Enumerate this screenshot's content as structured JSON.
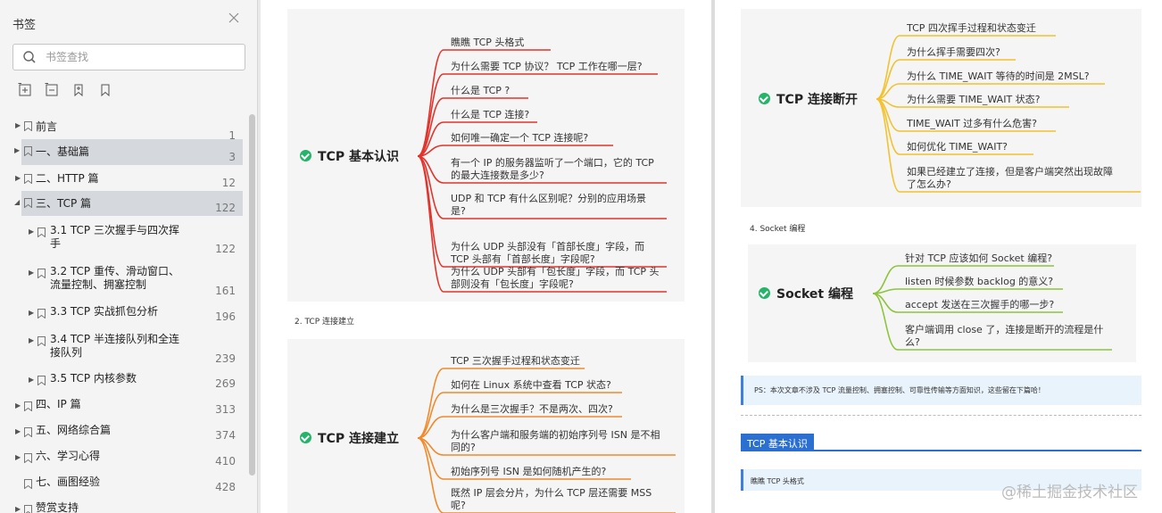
{
  "sidebar": {
    "title": "书签",
    "close_icon": "close-icon",
    "search": {
      "placeholder": "书签查找",
      "value": ""
    },
    "tools": [
      "expand-all-icon",
      "collapse-all-icon",
      "add-bookmark-icon",
      "bookmark-icon"
    ],
    "items": [
      {
        "label": "前言",
        "page": "1",
        "level": 0,
        "expanded": false,
        "selected": false
      },
      {
        "label": "一、基础篇",
        "page": "3",
        "level": 0,
        "expanded": false,
        "selected": true
      },
      {
        "label": "二、HTTP 篇",
        "page": "12",
        "level": 0,
        "expanded": false,
        "selected": false
      },
      {
        "label": "三、TCP 篇",
        "page": "122",
        "level": 0,
        "expanded": true,
        "selected": true
      },
      {
        "label": "3.1 TCP 三次握手与四次挥",
        "label2": "手",
        "page": "122",
        "level": 1,
        "selected": false
      },
      {
        "label": "3.2 TCP 重传、滑动窗口、",
        "label2": "流量控制、拥塞控制",
        "page": "161",
        "level": 1,
        "selected": false
      },
      {
        "label": "3.3   TCP 实战抓包分析",
        "page": "196",
        "level": 1,
        "selected": false
      },
      {
        "label": "3.4 TCP 半连接队列和全连",
        "label2": "接队列",
        "page": "239",
        "level": 1,
        "selected": false
      },
      {
        "label": "3.5 TCP 内核参数",
        "page": "269",
        "level": 1,
        "selected": false
      },
      {
        "label": "四、IP 篇",
        "page": "313",
        "level": 0,
        "selected": false
      },
      {
        "label": "五、网络综合篇",
        "page": "374",
        "level": 0,
        "selected": false
      },
      {
        "label": "六、学习心得",
        "page": "410",
        "level": 0,
        "selected": false
      },
      {
        "label": "七、画图经验",
        "page": "428",
        "level": 0,
        "selected": false
      },
      {
        "label": "赞赏支持",
        "page": "",
        "level": 0,
        "selected": false
      }
    ]
  },
  "document": {
    "left_page": {
      "mindmap1": {
        "title": "TCP 基本认识",
        "color": "#e0342c",
        "leaves": [
          "瞧瞧 TCP 头格式",
          "为什么需要 TCP 协议？ TCP 工作在哪一层?",
          "什么是 TCP ?",
          "什么是 TCP 连接?",
          "如何唯一确定一个 TCP 连接呢?",
          "有一个 IP 的服务器监听了一个端口，它的 TCP|的最大连接数是多少?",
          "UDP 和 TCP 有什么区别呢？分别的应用场景|是?",
          "为什么 UDP 头部没有「首部长度」字段，而|TCP 头部有「首部长度」字段呢?",
          "为什么 UDP 头部有「包长度」字段，而 TCP 头|部则没有「包长度」字段呢?"
        ]
      },
      "caption": "2. TCP 连接建立",
      "mindmap2": {
        "title": "TCP 连接建立",
        "color": "#f08a2c",
        "leaves": [
          "TCP 三次握手过程和状态变迁",
          "如何在 Linux 系统中查看 TCP 状态?",
          "为什么是三次握手？不是两次、四次?",
          "为什么客户端和服务端的初始序列号 ISN 是不相|同的?",
          "初始序列号 ISN 是如何随机产生的?",
          "既然 IP 层会分片，为什么 TCP 层还需要 MSS|呢?"
        ]
      }
    },
    "right_page": {
      "mindmap3": {
        "title": "TCP 连接断开",
        "color": "#f2c230",
        "leaves": [
          "TCP 四次挥手过程和状态变迁",
          "为什么挥手需要四次?",
          "为什么 TIME_WAIT 等待的时间是 2MSL?",
          "为什么需要 TIME_WAIT 状态?",
          "TIME_WAIT 过多有什么危害?",
          "如何优化 TIME_WAIT?",
          "如果已经建立了连接，但是客户端突然出现故障|了怎么办?"
        ]
      },
      "caption": "4. Socket 编程",
      "mindmap4": {
        "title": "Socket 编程",
        "color": "#8cc43c",
        "leaves": [
          "针对 TCP 应该如何 Socket 编程?",
          "listen 时候参数 backlog 的意义?",
          "accept 发送在三次握手的哪一步?",
          "客户端调用 close 了，连接是断开的流程是什|么?"
        ]
      },
      "ps_note": "PS：本次文章不涉及 TCP 流量控制、拥塞控制、可靠性传输等方面知识，这些留在下篇哈！",
      "section_tab": "TCP 基本认识",
      "band_text": "瞧瞧 TCP 头格式",
      "watermark": "@稀土掘金技术社区"
    }
  }
}
